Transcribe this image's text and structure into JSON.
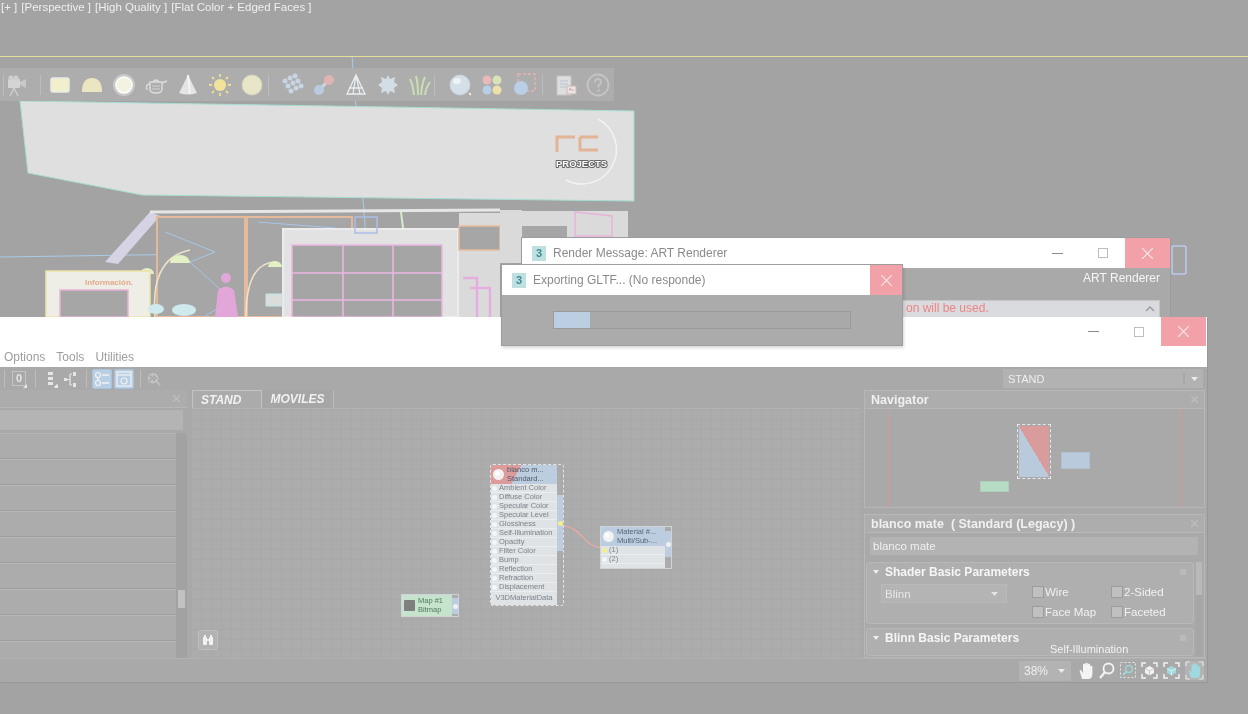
{
  "viewport": {
    "labels": [
      "[+ ]",
      "[Perspective ]",
      "[High Quality ]",
      "[Flat Color + Edged Faces ]"
    ],
    "logo_text": "PROJECTS",
    "desk_text": "Información."
  },
  "render_message": {
    "icon_label": "3",
    "title": "Render Message: ART Renderer",
    "renderer": "ART Renderer",
    "log": [
      "on will be used."
    ]
  },
  "export_dialog": {
    "icon_label": "3",
    "title": "Exporting GLTF... (No responde)",
    "progress": {
      "level": 0.12
    }
  },
  "slate_editor": {
    "menu": [
      "Options",
      "Tools",
      "Utilities"
    ],
    "toolbar": [
      {
        "kind": "channel",
        "label": "0",
        "on": false,
        "disabled": false
      },
      {
        "kind": "layout-vertical",
        "on": false,
        "disabled": false
      },
      {
        "kind": "layout-horizontal",
        "on": false,
        "disabled": false
      },
      {
        "kind": "slots",
        "on": true,
        "disabled": false
      },
      {
        "kind": "preview",
        "on": true,
        "disabled": false
      },
      {
        "kind": "checker",
        "on": false,
        "disabled": true
      }
    ],
    "view_select": "STAND",
    "tabs": [
      {
        "label": "STAND",
        "selected": true
      },
      {
        "label": "MOVILES",
        "selected": false
      }
    ],
    "nodes": [
      {
        "kind": "material",
        "title": "blanco m...",
        "subtitle": "Standard...",
        "selected": true,
        "output_connected": true,
        "slots": [
          {
            "label": "Ambient Color",
            "connected": false
          },
          {
            "label": "Diffuse Color",
            "connected": false
          },
          {
            "label": "Specular Color",
            "connected": false
          },
          {
            "label": "Specular Level",
            "connected": false
          },
          {
            "label": "Glossiness",
            "connected": false
          },
          {
            "label": "Self-Illumination",
            "connected": false
          },
          {
            "label": "Opacity",
            "connected": false
          },
          {
            "label": "Filter Color",
            "connected": false
          },
          {
            "label": "Bump",
            "connected": false
          },
          {
            "label": "Reflection",
            "connected": false
          },
          {
            "label": "Refraction",
            "connected": false
          },
          {
            "label": "Displacement",
            "connected": false
          }
        ],
        "footer": "V3DMaterialData"
      },
      {
        "kind": "multi",
        "title": "Material #...",
        "subtitle": "Multi/Sub-...",
        "selected": false,
        "output_connected": false,
        "slots": [
          {
            "label": "(1)",
            "connected": true
          },
          {
            "label": "(2)",
            "connected": false
          }
        ]
      },
      {
        "kind": "map",
        "title": "Map #1",
        "subtitle": "Bitmap",
        "selected": false,
        "output_connected": false
      }
    ],
    "navigator": {
      "title": "Navigator"
    },
    "parameters": {
      "title": "blanco mate  ( Standard (Legacy) )",
      "name": "blanco mate",
      "rollouts": [
        {
          "kind": "shader",
          "title": "Shader Basic Parameters",
          "expanded": true,
          "shader": "Blinn",
          "options": [
            {
              "label": "Wire",
              "checked": false
            },
            {
              "label": "2-Sided",
              "checked": false
            },
            {
              "label": "Face Map",
              "checked": false
            },
            {
              "label": "Faceted",
              "checked": false
            }
          ]
        },
        {
          "kind": "basic",
          "title": "Blinn Basic Parameters",
          "expanded": true,
          "field_label": "Self-Illumination"
        }
      ]
    },
    "zoom": "38%"
  }
}
